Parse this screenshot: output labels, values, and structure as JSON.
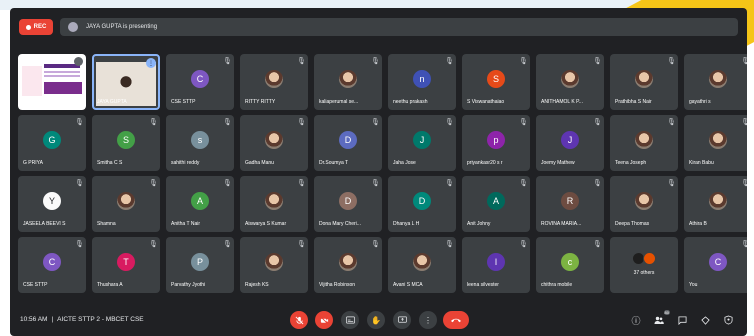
{
  "topbar": {
    "rec_label": "REC",
    "presenting_text": "JAYA GUPTA is presenting"
  },
  "participants": [
    {
      "name": "",
      "type": "share"
    },
    {
      "name": "JAYA GUPTA",
      "type": "active"
    },
    {
      "name": "CSE STTP",
      "initial": "C",
      "color": "#7e57c2"
    },
    {
      "name": "RITTY RITTY",
      "type": "photo"
    },
    {
      "name": "kaliaperumal se...",
      "type": "photo"
    },
    {
      "name": "neethu prakash",
      "initial": "n",
      "color": "#3f51b5"
    },
    {
      "name": "S Viswanathaiao",
      "initial": "S",
      "color": "#e64a19"
    },
    {
      "name": "ANITHAMOL K P...",
      "type": "photo"
    },
    {
      "name": "Prathibha S Nair",
      "type": "photo"
    },
    {
      "name": "gayathri s",
      "type": "photo"
    },
    {
      "name": "G PRIYA",
      "initial": "G",
      "color": "#00897b"
    },
    {
      "name": "Smitha C S",
      "initial": "S",
      "color": "#43a047"
    },
    {
      "name": "sahithi reddy",
      "initial": "s",
      "color": "#78909c"
    },
    {
      "name": "Gadha Manu",
      "type": "photo"
    },
    {
      "name": "Dr.Soumya T",
      "initial": "D",
      "color": "#5c6bc0"
    },
    {
      "name": "Jaha Jose",
      "initial": "J",
      "color": "#00796b"
    },
    {
      "name": "priyankasr20 s r",
      "initial": "p",
      "color": "#8e24aa"
    },
    {
      "name": "Joemy Mathew",
      "initial": "J",
      "color": "#5e35b1"
    },
    {
      "name": "Teena Joseph",
      "type": "photo"
    },
    {
      "name": "Kiran Babu",
      "type": "photo"
    },
    {
      "name": "JASEELA BEEVI S",
      "initial": "Y",
      "color": "#fafafa",
      "dark": true
    },
    {
      "name": "Shamna",
      "type": "photo"
    },
    {
      "name": "Anitha T Nair",
      "initial": "A",
      "color": "#43a047"
    },
    {
      "name": "Aiswarya S Kumar",
      "type": "photo"
    },
    {
      "name": "Dona Mary Cheri...",
      "initial": "D",
      "color": "#8d6e63"
    },
    {
      "name": "Dhanya L H",
      "initial": "D",
      "color": "#00897b"
    },
    {
      "name": "Anit Johny",
      "initial": "A",
      "color": "#00695c"
    },
    {
      "name": "ROVINA MARIA...",
      "initial": "R",
      "color": "#6d4c41"
    },
    {
      "name": "Deepa Thomas",
      "type": "photo"
    },
    {
      "name": "Athira B",
      "type": "photo"
    },
    {
      "name": "CSE STTP",
      "initial": "C",
      "color": "#7e57c2"
    },
    {
      "name": "Thushara A",
      "initial": "T",
      "color": "#d81b60"
    },
    {
      "name": "Parvathy Jyothi",
      "initial": "P",
      "color": "#78909c"
    },
    {
      "name": "Rajesh KS",
      "type": "photo"
    },
    {
      "name": "Vijitha Robinson",
      "type": "photo"
    },
    {
      "name": "Avani S MCA",
      "type": "photo"
    },
    {
      "name": "leena silvester",
      "initial": "l",
      "color": "#5e35b1"
    },
    {
      "name": "chithra mobile",
      "initial": "c",
      "color": "#7cb342"
    },
    {
      "name": "37 others",
      "type": "others"
    },
    {
      "name": "You",
      "initial": "C",
      "color": "#7e57c2"
    }
  ],
  "bottombar": {
    "time": "10:56 AM",
    "meeting": "AICTE STTP 2 - MBCET CSE",
    "people_count": "80"
  },
  "icons": {
    "mic": "microphone-off-icon",
    "camera": "camera-off-icon",
    "captions": "captions-icon",
    "hand": "raise-hand-icon",
    "present": "present-screen-icon",
    "more": "more-options-icon",
    "leave": "leave-call-icon",
    "info": "info-icon",
    "people": "people-icon",
    "chat": "chat-icon",
    "activities": "activities-icon",
    "host": "host-controls-icon"
  },
  "colors": {
    "background": "#202124",
    "tile": "#3c4043",
    "danger": "#ea4335",
    "accent": "#8ab4f8"
  }
}
